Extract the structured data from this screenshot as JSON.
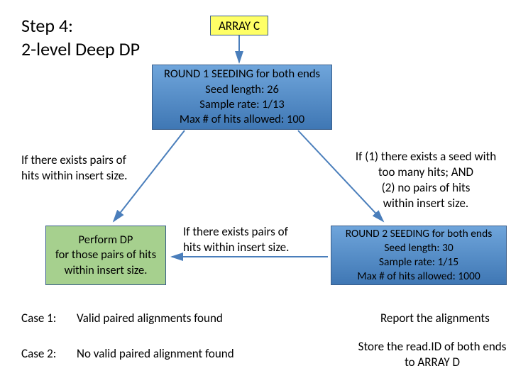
{
  "title_line1": "Step 4:",
  "title_line2": "2-level Deep DP",
  "array_c": "ARRAY C",
  "round1": {
    "heading": "ROUND 1 SEEDING for both ends",
    "seed_length": "Seed length: 26",
    "sample_rate": "Sample rate: 1/13",
    "max_hits": "Max # of hits allowed: 100"
  },
  "round2": {
    "heading": "ROUND 2 SEEDING for both ends",
    "seed_length": "Seed length: 30",
    "sample_rate": "Sample rate: 1/15",
    "max_hits": "Max # of hits allowed: 1000"
  },
  "perform_dp": {
    "line1": "Perform DP",
    "line2": "for those pairs of hits",
    "line3": "within insert size."
  },
  "left_cond": {
    "line1": "If there exists pairs of",
    "line2": "hits within insert size."
  },
  "right_cond": {
    "line1": "If (1) there exists a seed with",
    "line2": "too many hits; AND",
    "line3": "(2) no pairs of hits",
    "line4": "within insert size."
  },
  "mid_cond": {
    "line1": "If there exists pairs of",
    "line2": "hits within insert size."
  },
  "case1": {
    "label": "Case 1:",
    "text": "Valid paired alignments found",
    "result": "Report the alignments"
  },
  "case2": {
    "label": "Case 2:",
    "text": "No valid paired alignment found",
    "result": "Store the read.ID of both ends to ARRAY D"
  }
}
